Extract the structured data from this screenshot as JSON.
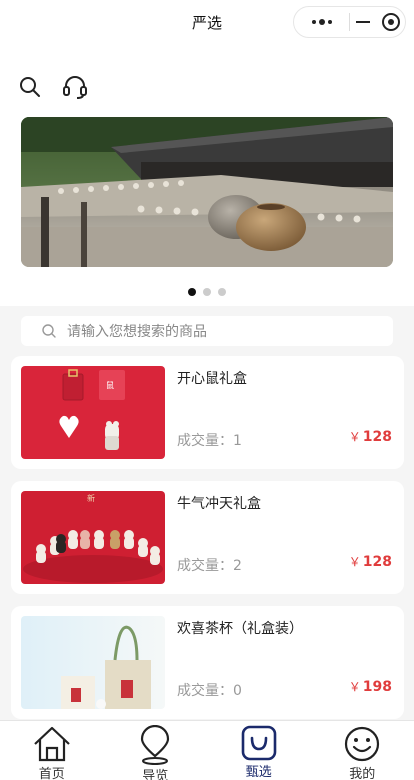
{
  "navbar": {
    "title": "严选"
  },
  "capsule": {
    "more_icon": "more-dots-icon",
    "minimize_icon": "minus-icon",
    "close_icon": "target-circle-icon"
  },
  "toolbar": {
    "search_icon": "search-icon",
    "service_icon": "headset-icon"
  },
  "banner": {
    "slides_total": 3,
    "active_index": 0
  },
  "search": {
    "placeholder": "请输入您想搜索的商品"
  },
  "products": [
    {
      "name": "开心鼠礼盒",
      "sales_label": "成交量：",
      "sales": "1",
      "currency": "￥",
      "price": "128"
    },
    {
      "name": "牛气冲天礼盒",
      "sales_label": "成交量：",
      "sales": "2",
      "currency": "￥",
      "price": "128"
    },
    {
      "name": "欢喜茶杯（礼盒装）",
      "sales_label": "成交量：",
      "sales": "0",
      "currency": "￥",
      "price": "198"
    }
  ],
  "tabbar": {
    "items": [
      {
        "label": "首页",
        "icon": "home-icon",
        "active": false
      },
      {
        "label": "导览",
        "icon": "location-pin-icon",
        "active": false
      },
      {
        "label": "甄选",
        "icon": "shopping-bag-icon",
        "active": true
      },
      {
        "label": "我的",
        "icon": "smiley-face-icon",
        "active": false
      }
    ]
  },
  "colors": {
    "price": "#e03c3c",
    "active_tab": "#1b2a6b",
    "background": "#f5f5f5"
  }
}
